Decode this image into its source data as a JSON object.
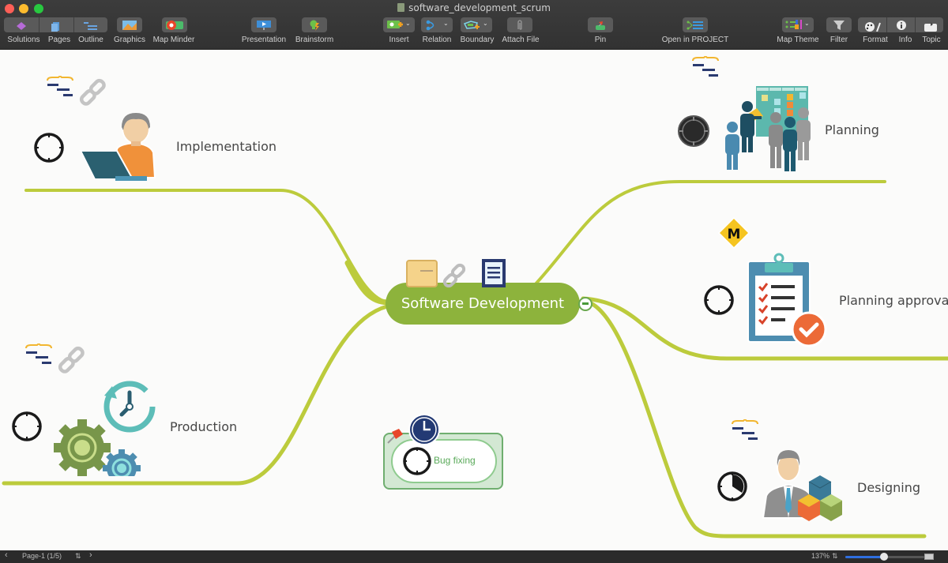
{
  "window": {
    "title": "software_development_scrum"
  },
  "toolbar": {
    "items": [
      {
        "id": "solutions",
        "label": "Solutions"
      },
      {
        "id": "pages",
        "label": "Pages"
      },
      {
        "id": "outline",
        "label": "Outline"
      },
      {
        "id": "graphics",
        "label": "Graphics"
      },
      {
        "id": "map-minder",
        "label": "Map Minder"
      },
      {
        "id": "presentation",
        "label": "Presentation"
      },
      {
        "id": "brainstorm",
        "label": "Brainstorm"
      },
      {
        "id": "insert",
        "label": "Insert"
      },
      {
        "id": "relation",
        "label": "Relation"
      },
      {
        "id": "boundary",
        "label": "Boundary"
      },
      {
        "id": "attach-file",
        "label": "Attach File"
      },
      {
        "id": "pin",
        "label": "Pin"
      },
      {
        "id": "open-in-project",
        "label": "Open in PROJECT"
      },
      {
        "id": "map-theme",
        "label": "Map Theme"
      },
      {
        "id": "filter",
        "label": "Filter"
      },
      {
        "id": "format",
        "label": "Format"
      },
      {
        "id": "info",
        "label": "Info"
      },
      {
        "id": "topic",
        "label": "Topic"
      }
    ]
  },
  "map": {
    "central_topic": {
      "label": "Software Development",
      "icons": [
        "folder-icon",
        "link-icon",
        "note-icon"
      ]
    },
    "branch_color": "#bccb3c",
    "central_color": "#8db33c",
    "topics": [
      {
        "label": "Implementation",
        "icons": [
          "summary-icon",
          "link-icon",
          "progress-0-icon",
          "developer-laptop-icon"
        ]
      },
      {
        "label": "Production",
        "icons": [
          "summary-icon",
          "link-icon",
          "progress-0-icon",
          "gears-clock-icon"
        ]
      },
      {
        "label": "Planning",
        "icons": [
          "summary-icon",
          "progress-full-icon",
          "team-board-icon"
        ]
      },
      {
        "label": "Planning approval",
        "icons": [
          "milestone-icon",
          "progress-0-icon",
          "clipboard-checklist-icon"
        ]
      },
      {
        "label": "Designing",
        "icons": [
          "summary-icon",
          "progress-75-icon",
          "designer-cubes-icon"
        ]
      }
    ],
    "floating_topic": {
      "label": "Bug fixing",
      "icons": [
        "pin-icon",
        "clock-icon",
        "progress-0-icon"
      ]
    },
    "milestone_letter": "M"
  },
  "statusbar": {
    "page": "Page-1 (1/5)",
    "zoom": "137%",
    "zoom_fraction": 0.49
  }
}
